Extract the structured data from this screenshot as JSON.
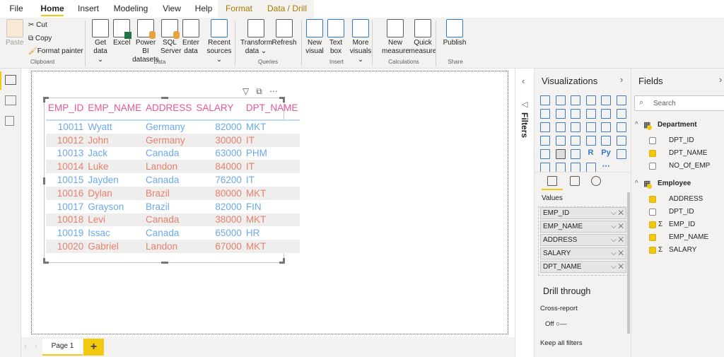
{
  "ribbon_tabs": [
    {
      "label": "File"
    },
    {
      "label": "Home",
      "active": true
    },
    {
      "label": "Insert"
    },
    {
      "label": "Modeling"
    },
    {
      "label": "View"
    },
    {
      "label": "Help"
    },
    {
      "label": "Format",
      "contextual": true
    },
    {
      "label": "Data / Drill",
      "contextual": true
    }
  ],
  "clipboard": {
    "paste": "Paste",
    "cut": "Cut",
    "copy": "Copy",
    "format_painter": "Format painter"
  },
  "ribbon_buttons": [
    {
      "label": "Get data ⌄",
      "icon": "database-icon"
    },
    {
      "label": "Excel",
      "icon": "excel-icon"
    },
    {
      "label": "Power BI datasets",
      "icon": "dataset-icon"
    },
    {
      "label": "SQL Server",
      "icon": "sql-server-icon"
    },
    {
      "label": "Enter data",
      "icon": "table-icon"
    },
    {
      "label": "Recent sources ⌄",
      "icon": "recent-sources-icon"
    },
    {
      "label": "Transform data ⌄",
      "icon": "transform-icon"
    },
    {
      "label": "Refresh",
      "icon": "refresh-icon"
    },
    {
      "label": "New visual",
      "icon": "new-visual-icon"
    },
    {
      "label": "Text box",
      "icon": "text-box-icon"
    },
    {
      "label": "More visuals ⌄",
      "icon": "more-visuals-icon"
    },
    {
      "label": "New measure",
      "icon": "calculator-icon"
    },
    {
      "label": "Quick measure",
      "icon": "quick-measure-icon"
    },
    {
      "label": "Publish",
      "icon": "publish-icon"
    }
  ],
  "ribbon_groups": [
    "Clipboard",
    "Data",
    "Queries",
    "Insert",
    "Calculations",
    "Share"
  ],
  "table": {
    "columns": [
      "EMP_ID",
      "EMP_NAME",
      "ADDRESS",
      "SALARY",
      "DPT_NAME"
    ],
    "rows": [
      [
        "10011",
        "Wyatt",
        "Germany",
        "82000",
        "MKT"
      ],
      [
        "10012",
        "John",
        "Germany",
        "30000",
        "IT"
      ],
      [
        "10013",
        "Jack",
        "Canada",
        "63000",
        "PHM"
      ],
      [
        "10014",
        "Luke",
        "Landon",
        "84000",
        "IT"
      ],
      [
        "10015",
        "Jayden",
        "Canada",
        "76200",
        "IT"
      ],
      [
        "10016",
        "Dylan",
        "Brazil",
        "80000",
        "MKT"
      ],
      [
        "10017",
        "Grayson",
        "Brazil",
        "82000",
        "FIN"
      ],
      [
        "10018",
        "Levi",
        "Canada",
        "38000",
        "MKT"
      ],
      [
        "10019",
        "Issac",
        "Canada",
        "65000",
        "HR"
      ],
      [
        "10020",
        "Gabriel",
        "Landon",
        "67000",
        "MKT"
      ]
    ],
    "colors": {
      "header": "#e8569a",
      "odd": "#6ba9ee",
      "even": "#e8806a"
    }
  },
  "visual_header": {
    "filter": "filter-icon",
    "focus": "focus-mode-icon",
    "more": "⋯"
  },
  "pages": {
    "tabs": [
      "Page 1"
    ],
    "add": "+"
  },
  "filters": {
    "label": "Filters"
  },
  "visualizations": {
    "title": "Visualizations",
    "icons": [
      "stacked-bar-icon",
      "stacked-column-icon",
      "clustered-bar-icon",
      "clustered-column-icon",
      "100-bar-icon",
      "100-column-icon",
      "line-chart-icon",
      "area-chart-icon",
      "stacked-area-icon",
      "line-column-icon",
      "line-clustered-column-icon",
      "ribbon-chart-icon",
      "waterfall-icon",
      "funnel-icon",
      "scatter-icon",
      "pie-icon",
      "donut-icon",
      "treemap-icon",
      "map-icon",
      "filled-map-icon",
      "gauge-icon",
      "card-icon",
      "multi-row-card-icon",
      "kpi-icon",
      "slicer-icon",
      "table-visual-icon",
      "matrix-icon",
      "r-visual-icon",
      "python-visual-icon",
      "key-influencers-icon",
      "decomposition-tree-icon",
      "qa-icon",
      "paginated-report-icon",
      "power-apps-icon",
      "more-icon"
    ],
    "icon_glyphs": {
      "r-visual-icon": "R",
      "python-visual-icon": "Py",
      "more-icon": "⋯"
    },
    "values_label": "Values",
    "wells": [
      "EMP_ID",
      "EMP_NAME",
      "ADDRESS",
      "SALARY",
      "DPT_NAME"
    ],
    "drill_through": "Drill through",
    "cross_report": "Cross-report",
    "cross_report_state": "Off",
    "keep_all_filters": "Keep all filters"
  },
  "fields": {
    "title": "Fields",
    "search_placeholder": "Search",
    "tables": [
      {
        "name": "Department",
        "fields": [
          {
            "name": "DPT_ID",
            "checked": false
          },
          {
            "name": "DPT_NAME",
            "checked": true
          },
          {
            "name": "NO_Of_EMP",
            "checked": false
          }
        ]
      },
      {
        "name": "Employee",
        "fields": [
          {
            "name": "ADDRESS",
            "checked": true
          },
          {
            "name": "DPT_ID",
            "checked": false
          },
          {
            "name": "EMP_ID",
            "checked": true,
            "sigma": "Σ"
          },
          {
            "name": "EMP_NAME",
            "checked": true
          },
          {
            "name": "SALARY",
            "checked": true,
            "sigma": "Σ"
          }
        ]
      }
    ]
  }
}
